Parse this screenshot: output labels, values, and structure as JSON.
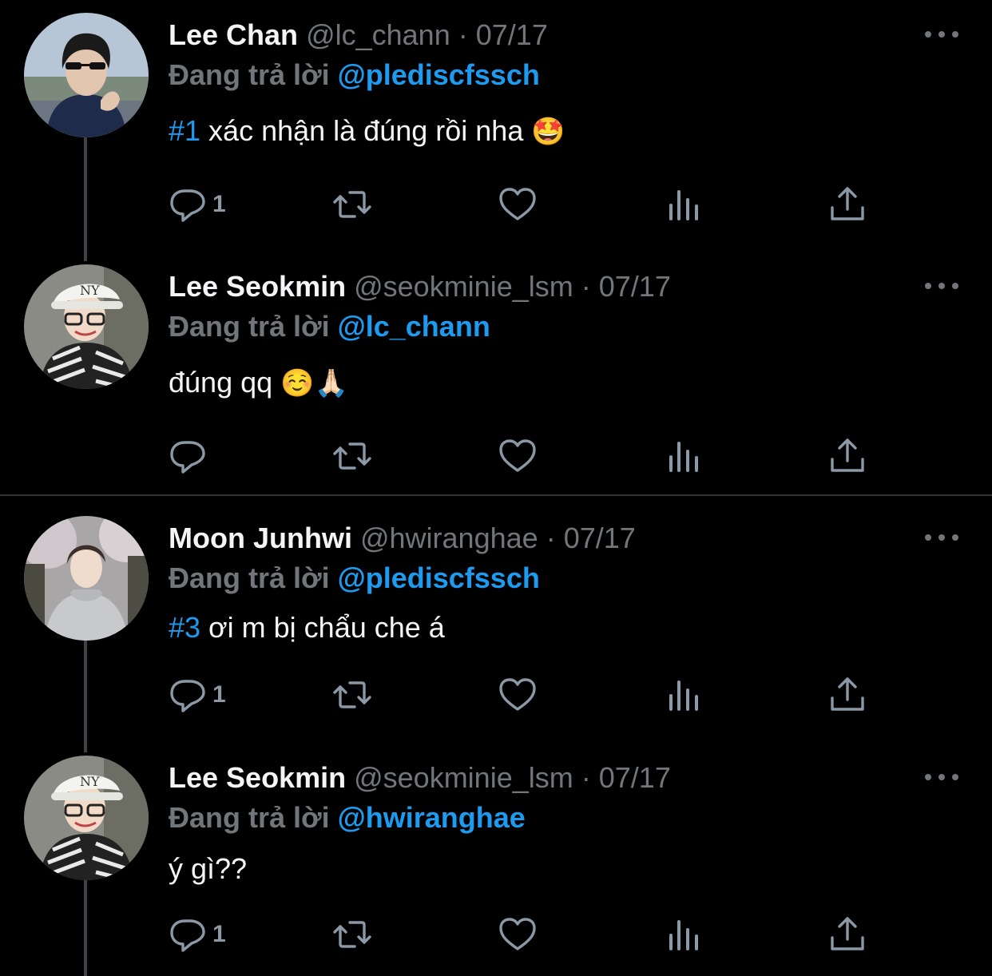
{
  "labels": {
    "reply_prefix": "Đang trả lời"
  },
  "colors": {
    "background": "#000000",
    "accent": "#1d9bf0",
    "secondary_text": "#71767b",
    "primary_text": "#e7e9ea"
  },
  "tweets": [
    {
      "name": "Lee Chan",
      "handle": "@lc_chann",
      "sep": "·",
      "date": "07/17",
      "reply_to": "@pledisсfssch",
      "hashtag": "#1",
      "text": " xác nhận là đúng rồi nha ",
      "emoji": "🤩",
      "reply_count": "1",
      "icons": [
        "reply-icon",
        "retweet-icon",
        "like-icon",
        "analytics-icon",
        "share-icon"
      ]
    },
    {
      "name": "Lee Seokmin",
      "handle": "@seokminie_lsm",
      "sep": "·",
      "date": "07/17",
      "reply_to": "@lc_chann",
      "hashtag": "",
      "text": "đúng qq ",
      "emoji": "☺️🙏🏻",
      "reply_count": "",
      "icons": [
        "reply-icon",
        "retweet-icon",
        "like-icon",
        "analytics-icon",
        "share-icon"
      ]
    },
    {
      "name": "Moon Junhwi",
      "handle": "@hwiranghae",
      "sep": "·",
      "date": "07/17",
      "reply_to": "@pledisсfssch",
      "hashtag": "#3",
      "text": " ơi m bị chẩu che á",
      "emoji": "",
      "reply_count": "1",
      "icons": [
        "reply-icon",
        "retweet-icon",
        "like-icon",
        "analytics-icon",
        "share-icon"
      ]
    },
    {
      "name": "Lee Seokmin",
      "handle": "@seokminie_lsm",
      "sep": "·",
      "date": "07/17",
      "reply_to": "@hwiranghae",
      "hashtag": "",
      "text": "ý gì??",
      "emoji": "",
      "reply_count": "1",
      "icons": [
        "reply-icon",
        "retweet-icon",
        "like-icon",
        "analytics-icon",
        "share-icon"
      ]
    }
  ]
}
